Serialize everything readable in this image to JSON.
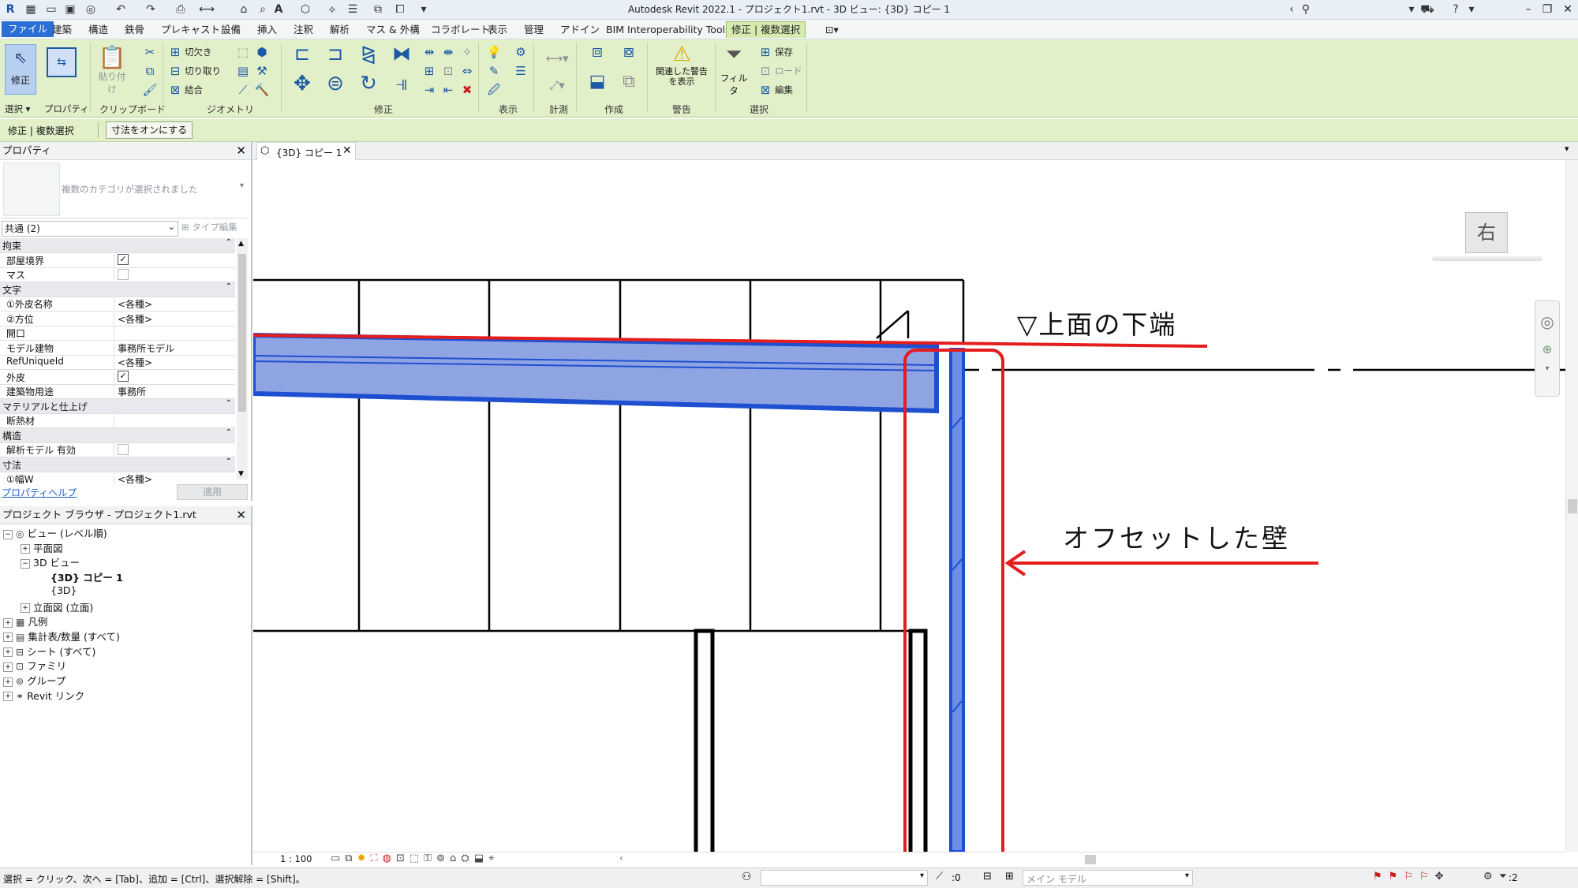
{
  "app": {
    "title": "Autodesk Revit 2022.1 - プロジェクト1.rvt - 3D ビュー: {3D} コピー 1"
  },
  "ribbon": {
    "tabs": [
      "ファイル",
      "建築",
      "構造",
      "鉄骨",
      "プレキャスト",
      "設備",
      "挿入",
      "注釈",
      "解析",
      "マス & 外構",
      "コラボレート",
      "表示",
      "管理",
      "アドイン",
      "BIM Interoperability Tools",
      "修正 | 複数選択"
    ],
    "buttons": {
      "modify": "修正",
      "select": "選択",
      "properties": "プロパティ",
      "paste": "貼り付け",
      "clipboard": "クリップボード",
      "cope": "切欠き",
      "cut": "切り取り",
      "join": "結合",
      "geometry": "ジオメトリ",
      "modify_group": "修正",
      "view_group": "表示",
      "measure": "計測",
      "create": "作成",
      "warnings_btn": "関連した警告を表示",
      "warnings_line1": "関連した警告",
      "warnings_line2": "を表示",
      "warning_group": "警告",
      "filter": "フィルタ",
      "save": "保存",
      "load": "ロード",
      "edit": "編集",
      "selection_group": "選択"
    }
  },
  "options_bar": {
    "context": "修正 | 複数選択",
    "dimension_toggle": "寸法をオンにする"
  },
  "properties": {
    "title": "プロパティ",
    "type_selector": "複数のカテゴリが選択されました",
    "filter": "共通 (2)",
    "edit_type": "タイプ編集",
    "rows": [
      {
        "kind": "cat",
        "label": "拘束"
      },
      {
        "kind": "chk",
        "label": "部屋境界",
        "checked": true,
        "enabled": true
      },
      {
        "kind": "chk",
        "label": "マス",
        "checked": false,
        "enabled": false
      },
      {
        "kind": "cat",
        "label": "文字"
      },
      {
        "kind": "val",
        "label": "①外皮名称",
        "value": "<各種>"
      },
      {
        "kind": "val",
        "label": "②方位",
        "value": "<各種>"
      },
      {
        "kind": "val",
        "label": "開口",
        "value": ""
      },
      {
        "kind": "val",
        "label": "モデル建物",
        "value": "事務所モデル"
      },
      {
        "kind": "val",
        "label": "RefUniqueId",
        "value": "<各種>"
      },
      {
        "kind": "chk",
        "label": "外皮",
        "checked": true,
        "enabled": true
      },
      {
        "kind": "val",
        "label": "建築物用途",
        "value": "事務所"
      },
      {
        "kind": "cat",
        "label": "マテリアルと仕上げ"
      },
      {
        "kind": "val",
        "label": "断熱材",
        "value": ""
      },
      {
        "kind": "cat",
        "label": "構造"
      },
      {
        "kind": "chk",
        "label": "解析モデル 有効",
        "checked": false,
        "enabled": false
      },
      {
        "kind": "cat",
        "label": "寸法"
      },
      {
        "kind": "val",
        "label": "①幅W",
        "value": "<各種>"
      }
    ],
    "help_link": "プロパティヘルプ",
    "apply_button": "適用"
  },
  "browser": {
    "title": "プロジェクト ブラウザ - プロジェクト1.rvt",
    "items": [
      {
        "label": "ビュー (レベル順)",
        "indent": 0,
        "toggle": "−"
      },
      {
        "label": "平面図",
        "indent": 1,
        "toggle": "+"
      },
      {
        "label": "3D ビュー",
        "indent": 1,
        "toggle": "−"
      },
      {
        "label": "{3D} コピー 1",
        "indent": 2,
        "toggle": "",
        "bold": true
      },
      {
        "label": "{3D}",
        "indent": 2,
        "toggle": ""
      },
      {
        "label": "立面図 (立面)",
        "indent": 1,
        "toggle": "+"
      },
      {
        "label": "凡例",
        "indent": 0,
        "toggle": "+"
      },
      {
        "label": "集計表/数量 (すべて)",
        "indent": 0,
        "toggle": "+"
      },
      {
        "label": "シート (すべて)",
        "indent": 0,
        "toggle": "+"
      },
      {
        "label": "ファミリ",
        "indent": 0,
        "toggle": "+"
      },
      {
        "label": "グループ",
        "indent": 0,
        "toggle": "+"
      },
      {
        "label": "Revit リンク",
        "indent": 0,
        "toggle": "+"
      }
    ]
  },
  "view": {
    "tab_label": "{3D} コピー 1",
    "viewcube_face": "右",
    "scale": "1 : 100",
    "annotation_top": "▽上面の下端",
    "annotation_wall": "オフセットした壁"
  },
  "status": {
    "hint": "選択 = クリック、次へ = [Tab]、追加 = [Ctrl]、選択解除 = [Shift]。",
    "coord": ":0",
    "model": "メイン モデル",
    "filter_count": ":2"
  },
  "colors": {
    "ribbon_context": "#e2f0c9",
    "file_tab": "#2a6fd6",
    "selection_blue": "#1f4fd1",
    "selection_fill": "#8ea4e3",
    "annotation_red": "#e41d1d"
  }
}
